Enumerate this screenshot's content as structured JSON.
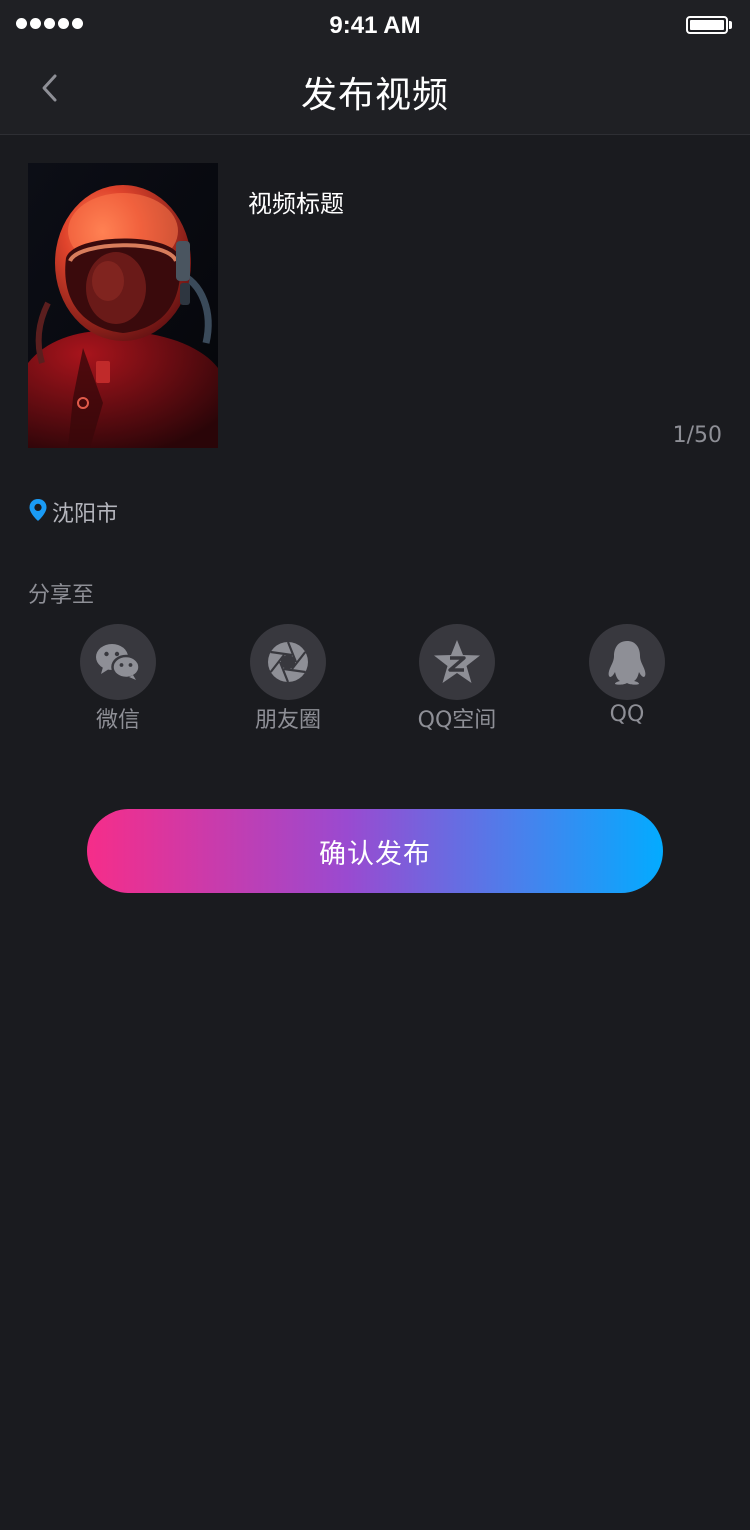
{
  "status_bar": {
    "time": "9:41 AM",
    "signal_icon": "signal-dots-icon",
    "battery_icon": "battery-full-icon"
  },
  "nav": {
    "back_icon": "chevron-left-icon",
    "title": "发布视频"
  },
  "video": {
    "cover_image": "astronaut-helmet-photo",
    "title_text": "视频标题",
    "char_counter": "1/50"
  },
  "location": {
    "icon": "map-pin-icon",
    "text": "沈阳市"
  },
  "share": {
    "label": "分享至",
    "targets": [
      {
        "label": "微信",
        "icon": "wechat-icon"
      },
      {
        "label": "朋友圈",
        "icon": "moments-aperture-icon"
      },
      {
        "label": "QQ空间",
        "icon": "qzone-star-icon"
      },
      {
        "label": "QQ",
        "icon": "qq-penguin-icon"
      }
    ]
  },
  "confirm_button": {
    "label": "确认发布"
  },
  "colors": {
    "background": "#1a1b1f",
    "bar_background": "#1f2024",
    "icon_circle": "#38383e",
    "icon_glyph": "#8e8f96",
    "muted_text": "#8e8f96",
    "location_pin": "#1a9bf5",
    "gradient_start": "#f62d89",
    "gradient_end": "#03abff"
  }
}
